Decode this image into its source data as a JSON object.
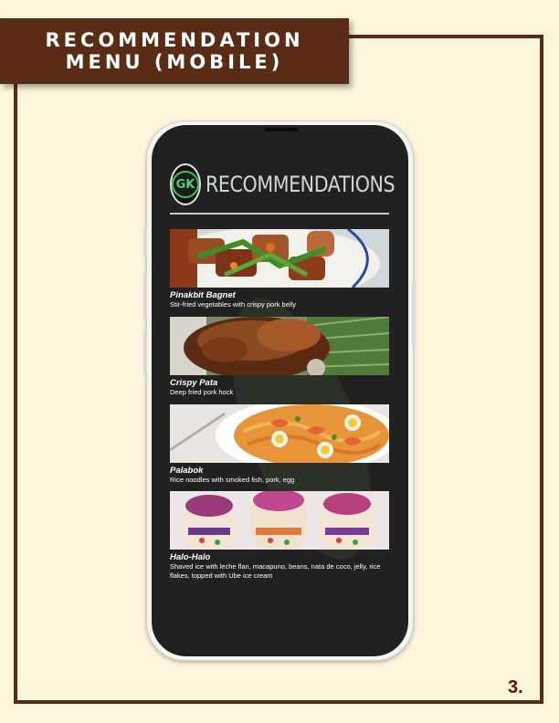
{
  "header": {
    "title_line1": "RECOMMENDATION",
    "title_line2": "MENU (MOBILE)"
  },
  "page_number": "3.",
  "app": {
    "logo_text": "GK",
    "title": "RECOMMENDATIONS"
  },
  "menu_items": [
    {
      "name": "Pinakbit Bagnet",
      "description": "Stir-fried vegetables with crispy pork belly"
    },
    {
      "name": "Crispy Pata",
      "description": "Deep fried pork hock"
    },
    {
      "name": "Palabok",
      "description": "Rice noodles with smoked fish, pork, egg"
    },
    {
      "name": "Halo-Halo",
      "description": "Shaved ice with leche flan, macapuno, beans, nata de coco, jelly, rice flakes, topped with Ube ice cream"
    }
  ],
  "colors": {
    "background": "#fdf6dc",
    "brand_brown": "#5a2c16",
    "screen": "#212121",
    "page_number": "#5a1414"
  }
}
